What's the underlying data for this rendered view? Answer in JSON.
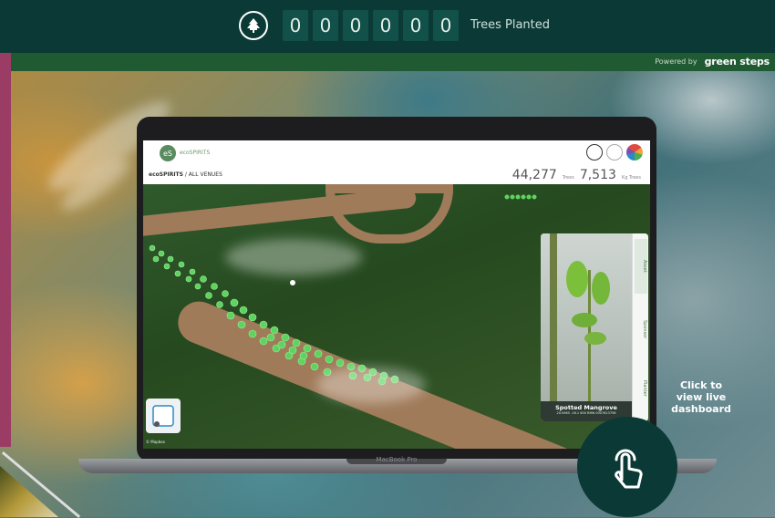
{
  "header": {
    "counter_digits": [
      "0",
      "0",
      "0",
      "0",
      "0",
      "0"
    ],
    "counter_label": "Trees Planted",
    "powered_by": "Powered by",
    "brand": "green steps"
  },
  "laptop": {
    "model_label": "MacBook Pro",
    "app": {
      "logo_text": "ecoSPIRITS",
      "breadcrumb_bold": "ecoSPIRITS",
      "breadcrumb_rest": " / ALL VENUES",
      "stat1_value": "44,277",
      "stat1_unit": "Trees",
      "stat2_value": "7,513",
      "stat2_unit": "Kg Trees",
      "card": {
        "title": "Spotted Mangrove",
        "coords": "20.0965 -16.1 600 RMN 0007623756",
        "tabs": [
          "Asset",
          "Sponsor",
          "Planter"
        ]
      },
      "map_attribution": "© Mapbox"
    }
  },
  "cta": {
    "text": "Click to view live dashboard"
  }
}
